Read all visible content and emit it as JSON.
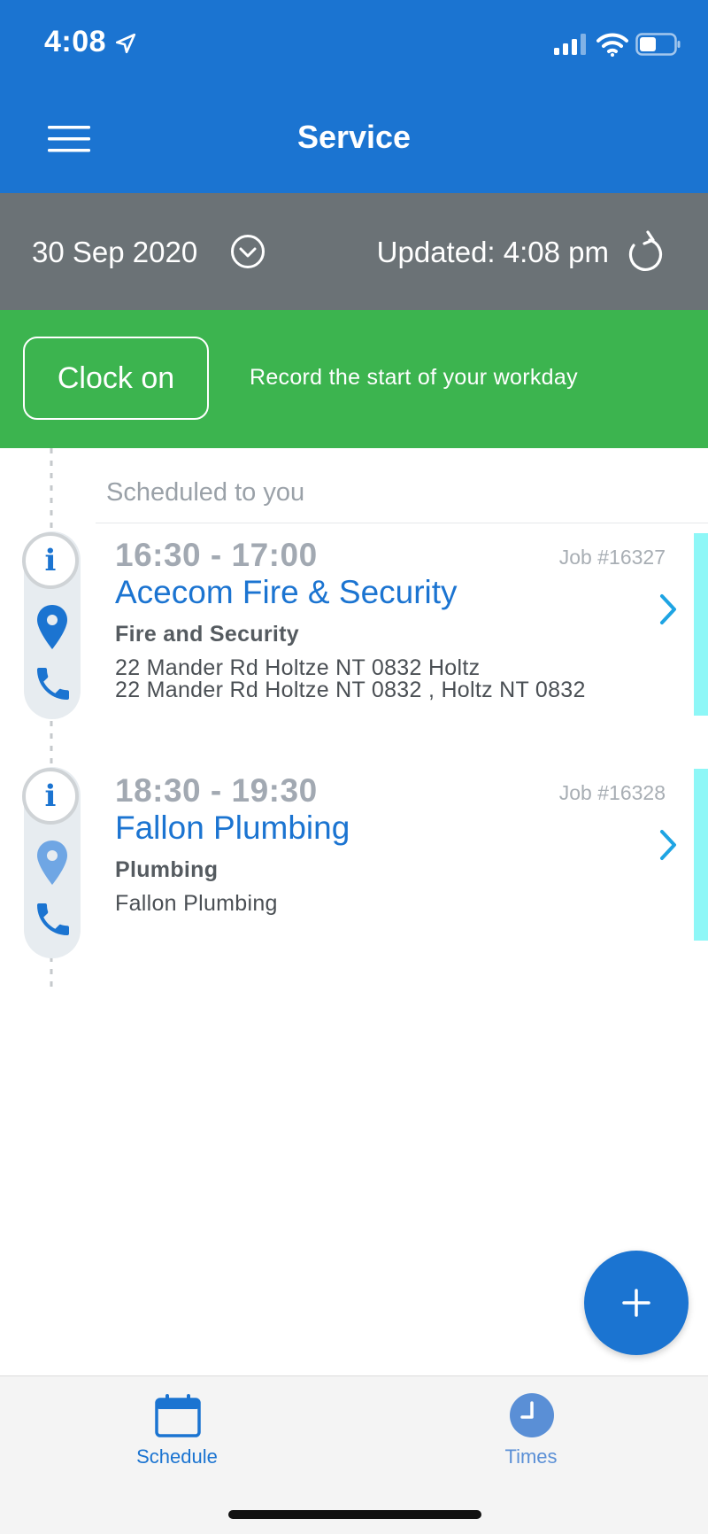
{
  "status_bar": {
    "time": "4:08"
  },
  "header": {
    "title": "Service"
  },
  "date_bar": {
    "date": "30 Sep 2020",
    "updated": "Updated: 4:08 pm"
  },
  "clock": {
    "button_label": "Clock on",
    "description": "Record the start of your workday"
  },
  "schedule": {
    "section_title": "Scheduled to you",
    "jobs": [
      {
        "time": "16:30 - 17:00",
        "job_number": "Job #16327",
        "client": "Acecom Fire & Security",
        "type": "Fire and Security",
        "address_line1": "22 Mander Rd Holtze NT 0832 Holtz",
        "address_line2": "22 Mander Rd Holtze NT 0832 , Holtz NT 0832"
      },
      {
        "time": "18:30 - 19:30",
        "job_number": "Job #16328",
        "client": "Fallon Plumbing",
        "type": "Plumbing",
        "address_line1": "Fallon Plumbing",
        "address_line2": ""
      }
    ]
  },
  "tabs": [
    {
      "label": "Schedule",
      "icon": "calendar-icon"
    },
    {
      "label": "Times",
      "icon": "clock-icon"
    }
  ],
  "colors": {
    "primary": "#1b74d1",
    "date_bar": "#6b7276",
    "clock_bar": "#3cb44f",
    "job_stripe": "#8ef7f7"
  }
}
